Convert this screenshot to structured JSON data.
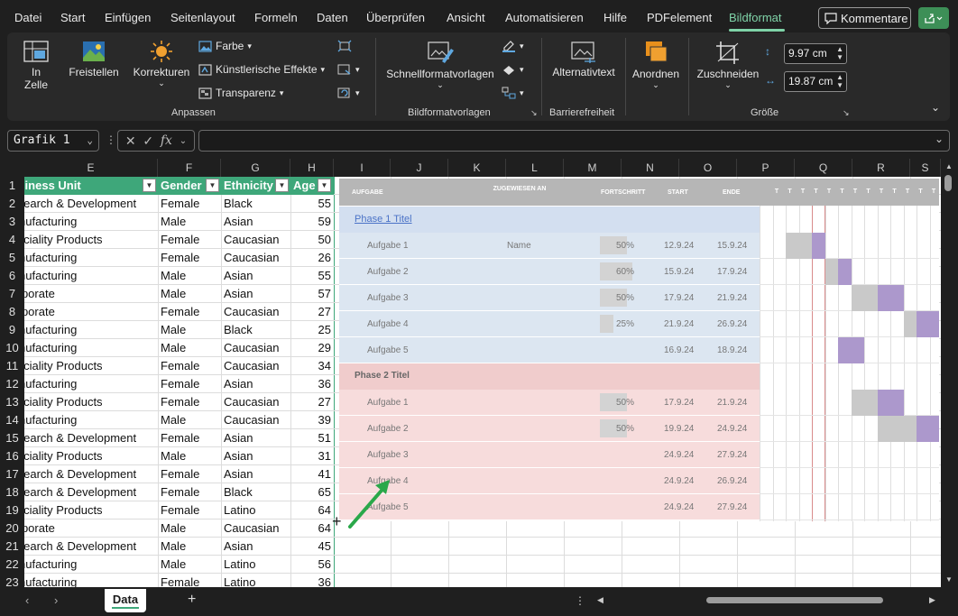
{
  "menu": {
    "items": [
      "Datei",
      "Start",
      "Einfügen",
      "Seitenlayout",
      "Formeln",
      "Daten",
      "Überprüfen",
      "Ansicht",
      "Automatisieren",
      "Hilfe",
      "PDFelement",
      "Bildformat"
    ],
    "active": "Bildformat",
    "comment_label": "Kommentare"
  },
  "ribbon": {
    "in_zelle": "In Zelle",
    "freistellen": "Freistellen",
    "korrekturen": "Korrekturen",
    "farbe": "Farbe",
    "kuenstlerisch": "Künstlerische Effekte",
    "transparenz": "Transparenz",
    "anpassen_label": "Anpassen",
    "schnellformat": "Schnellformatvorlagen",
    "bildformatvorlagen_label": "Bildformatvorlagen",
    "alternativtext": "Alternativtext",
    "barrierefreiheit_label": "Barrierefreiheit",
    "anordnen": "Anordnen",
    "zuschneiden": "Zuschneiden",
    "height_value": "9.97 cm",
    "width_value": "19.87 cm",
    "groesse_label": "Größe"
  },
  "formula": {
    "namebox": "Grafik 1",
    "formula_value": ""
  },
  "columns": [
    "E",
    "F",
    "G",
    "H",
    "I",
    "J",
    "K",
    "L",
    "M",
    "N",
    "O",
    "P",
    "Q",
    "R",
    "S"
  ],
  "table": {
    "headers": [
      "Business Unit",
      "Gender",
      "Ethnicity",
      "Age"
    ],
    "rows": [
      [
        "Research & Development",
        "Female",
        "Black",
        "55"
      ],
      [
        "Manufacturing",
        "Male",
        "Asian",
        "59"
      ],
      [
        "Speciality Products",
        "Female",
        "Caucasian",
        "50"
      ],
      [
        "Manufacturing",
        "Female",
        "Caucasian",
        "26"
      ],
      [
        "Manufacturing",
        "Male",
        "Asian",
        "55"
      ],
      [
        "Corporate",
        "Male",
        "Asian",
        "57"
      ],
      [
        "Corporate",
        "Female",
        "Caucasian",
        "27"
      ],
      [
        "Manufacturing",
        "Male",
        "Black",
        "25"
      ],
      [
        "Manufacturing",
        "Male",
        "Caucasian",
        "29"
      ],
      [
        "Speciality Products",
        "Female",
        "Caucasian",
        "34"
      ],
      [
        "Manufacturing",
        "Female",
        "Asian",
        "36"
      ],
      [
        "Speciality Products",
        "Female",
        "Caucasian",
        "27"
      ],
      [
        "Manufacturing",
        "Male",
        "Caucasian",
        "39"
      ],
      [
        "Research & Development",
        "Female",
        "Asian",
        "51"
      ],
      [
        "Speciality Products",
        "Male",
        "Asian",
        "31"
      ],
      [
        "Research & Development",
        "Female",
        "Asian",
        "41"
      ],
      [
        "Research & Development",
        "Female",
        "Black",
        "65"
      ],
      [
        "Speciality Products",
        "Female",
        "Latino",
        "64"
      ],
      [
        "Corporate",
        "Male",
        "Caucasian",
        "64"
      ],
      [
        "Research & Development",
        "Male",
        "Asian",
        "45"
      ],
      [
        "Manufacturing",
        "Male",
        "Latino",
        "56"
      ],
      [
        "Manufacturing",
        "Female",
        "Latino",
        "36"
      ]
    ]
  },
  "gantt": {
    "headers": {
      "aufgabe": "AUFGABE",
      "zugewiesen": "ZUGEWIESEN AN",
      "fortschritt": "FORTSCHRITT",
      "start": "START",
      "ende": "ENDE",
      "day_letter": "T"
    },
    "phase1_title": "Phase 1 Titel",
    "phase2_title": "Phase 2 Titel",
    "phase1_tasks": [
      {
        "name": "Aufgabe 1",
        "assignee": "Name",
        "progress": "50%",
        "start": "12.9.24",
        "end": "15.9.24"
      },
      {
        "name": "Aufgabe 2",
        "assignee": "",
        "progress": "60%",
        "start": "15.9.24",
        "end": "17.9.24"
      },
      {
        "name": "Aufgabe 3",
        "assignee": "",
        "progress": "50%",
        "start": "17.9.24",
        "end": "21.9.24"
      },
      {
        "name": "Aufgabe 4",
        "assignee": "",
        "progress": "25%",
        "start": "21.9.24",
        "end": "26.9.24"
      },
      {
        "name": "Aufgabe 5",
        "assignee": "",
        "progress": "",
        "start": "16.9.24",
        "end": "18.9.24"
      }
    ],
    "phase2_tasks": [
      {
        "name": "Aufgabe 1",
        "assignee": "",
        "progress": "50%",
        "start": "17.9.24",
        "end": "21.9.24"
      },
      {
        "name": "Aufgabe 2",
        "assignee": "",
        "progress": "50%",
        "start": "19.9.24",
        "end": "24.9.24"
      },
      {
        "name": "Aufgabe 3",
        "assignee": "",
        "progress": "",
        "start": "24.9.24",
        "end": "27.9.24"
      },
      {
        "name": "Aufgabe 4",
        "assignee": "",
        "progress": "",
        "start": "24.9.24",
        "end": "26.9.24"
      },
      {
        "name": "Aufgabe 5",
        "assignee": "",
        "progress": "",
        "start": "24.9.24",
        "end": "27.9.24"
      }
    ]
  },
  "sheets": {
    "active_tab": "Data"
  },
  "colors": {
    "accent": "#7fd3a8",
    "table_header": "#3ea77a",
    "phase1_bg": "#dce6f1",
    "phase2_bg": "#f7dcdc",
    "gantt_bar_purple": "#ac98cc",
    "gantt_bar_gray": "#c9c9c9"
  }
}
